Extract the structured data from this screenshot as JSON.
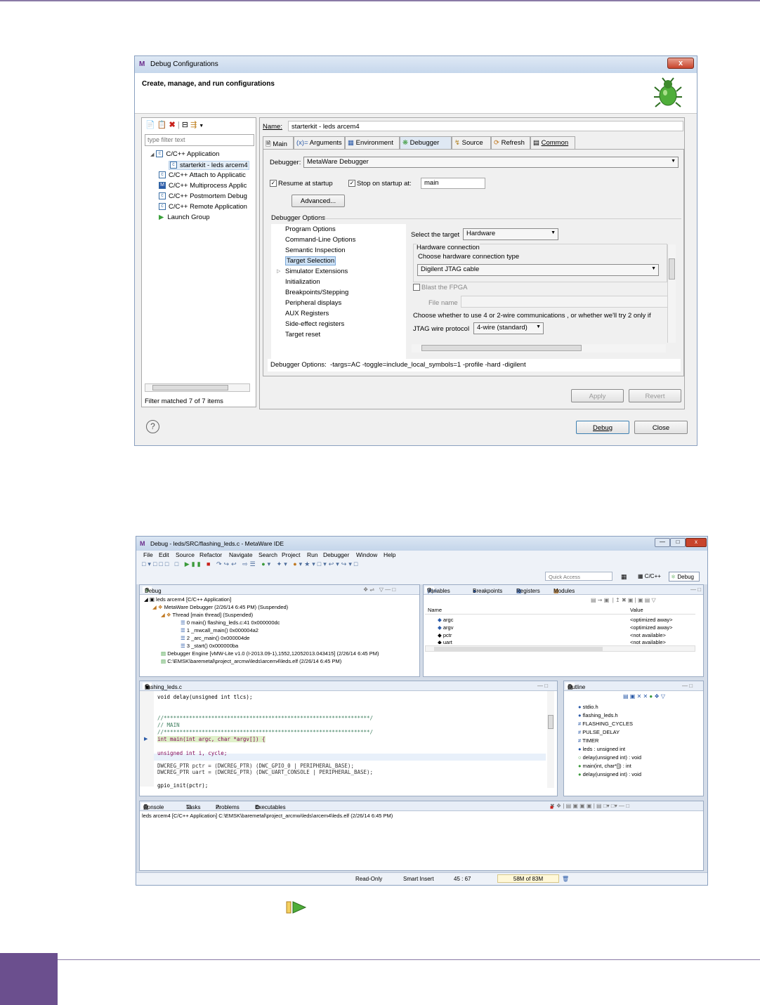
{
  "dialog": {
    "title": "Debug Configurations",
    "title_icon": "M",
    "close": "x",
    "heading": "Create, manage, and run configurations",
    "filter_placeholder": "type filter text",
    "tree": [
      "C/C++ Application",
      "starterkit - leds arcem4",
      "C/C++ Attach to Applicatic",
      "C/C++ Multiprocess Applic",
      "C/C++ Postmortem Debug",
      "C/C++ Remote Application",
      "Launch Group"
    ],
    "filter_status": "Filter matched 7 of 7 items",
    "name_label": "Name:",
    "name_value": "starterkit - leds arcem4",
    "tabs": [
      "Main",
      "Arguments",
      "Environment",
      "Debugger",
      "Source",
      "Refresh",
      "Common"
    ],
    "debugger_label": "Debugger:",
    "debugger_value": "MetaWare Debugger",
    "resume": "Resume at startup",
    "stop": "Stop on startup at:",
    "stop_value": "main",
    "advanced": "Advanced...",
    "options_group": "Debugger Options",
    "options": [
      "Program Options",
      "Command-Line Options",
      "Semantic Inspection",
      "Target Selection",
      "Simulator Extensions",
      "Initialization",
      "Breakpoints/Stepping",
      "Peripheral displays",
      "AUX Registers",
      "Side-effect registers",
      "Target reset"
    ],
    "select_target_label": "Select the target",
    "select_target_value": "Hardware",
    "hw_connection": "Hardware connection",
    "choose_hw": "Choose hardware connection type",
    "hw_value": "Digilent JTAG cable",
    "blast": "Blast the FPGA",
    "file_name": "File name",
    "wire_text": "Choose whether to use 4 or 2-wire communications , or whether we'll try 2 only if",
    "jtag_label": "JTAG wire protocol",
    "jtag_value": "4-wire (standard)",
    "options_line_label": "Debugger Options:",
    "options_line_value": "-targs=AC -toggle=include_local_symbols=1 -profile -hard -digilent",
    "apply": "Apply",
    "revert": "Revert",
    "debug": "Debug",
    "close_btn": "Close",
    "help": "?"
  },
  "ide": {
    "title": "Debug - leds/SRC/flashing_leds.c - MetaWare IDE",
    "menu": [
      "File",
      "Edit",
      "Source",
      "Refactor",
      "Navigate",
      "Search",
      "Project",
      "Run",
      "Debugger",
      "Window",
      "Help"
    ],
    "quick_access": "Quick Access",
    "persp1": "C/C++",
    "persp2": "Debug",
    "debug_tab": "Debug",
    "debug_tree": [
      "leds arcem4 [C/C++ Application]",
      "MetaWare Debugger (2/26/14 6:45 PM) (Suspended)",
      "Thread [main thread] (Suspended)",
      "0 main() flashing_leds.c:41 0x000000dc",
      "1 _mwcall_main()  0x000004a2",
      "2 _arc_main()  0x000004de",
      "3 _start()  0x000000ba",
      "Debugger Engine [vMW-Lite v1.0 (I-2013.09-1),1552,12052013.043415] (2/26/14 6:45 PM)",
      "C:\\EMSK\\baremetal\\project_arcmw\\leds\\arcem4\\leds.elf (2/26/14 6:45 PM)"
    ],
    "var_tabs": [
      "Variables",
      "Breakpoints",
      "Registers",
      "Modules"
    ],
    "var_cols": [
      "Name",
      "Value"
    ],
    "vars": [
      [
        "argc",
        "<optimized away>"
      ],
      [
        "argv",
        "<optimized away>"
      ],
      [
        "pctr",
        "<not available>"
      ],
      [
        "uart",
        "<not available>"
      ]
    ],
    "editor_tab": "flashing_leds.c",
    "code": [
      "void delay(unsigned int tlcs);",
      "",
      "//*****************************************************************/",
      "//  MAIN",
      "//*****************************************************************/",
      "int main(int argc, char *argv[]) {",
      "",
      "    unsigned int i, cycle;",
      "",
      "    DWCREG_PTR pctr = (DWCREG_PTR) (DWC_GPIO_0 | PERIPHERAL_BASE);",
      "    DWCREG_PTR uart = (DWCREG_PTR) (DWC_UART_CONSOLE | PERIPHERAL_BASE);",
      "",
      "    gpio_init(pctr);"
    ],
    "outline_tab": "Outline",
    "outline": [
      "stdio.h",
      "flashing_leds.h",
      "FLASHING_CYCLES",
      "PULSE_DELAY",
      "TIMER",
      "leds : unsigned int",
      "delay(unsigned int) : void",
      "main(int, char*[]) : int",
      "delay(unsigned int) : void"
    ],
    "console_tabs": [
      "Console",
      "Tasks",
      "Problems",
      "Executables"
    ],
    "console_line": "leds arcem4 [C/C++ Application] C:\\EMSK\\baremetal\\project_arcmw\\leds\\arcem4\\leds.elf (2/26/14 6:45 PM)",
    "status": [
      "Read-Only",
      "Smart Insert",
      "45 : 67",
      "58M of 83M"
    ]
  }
}
